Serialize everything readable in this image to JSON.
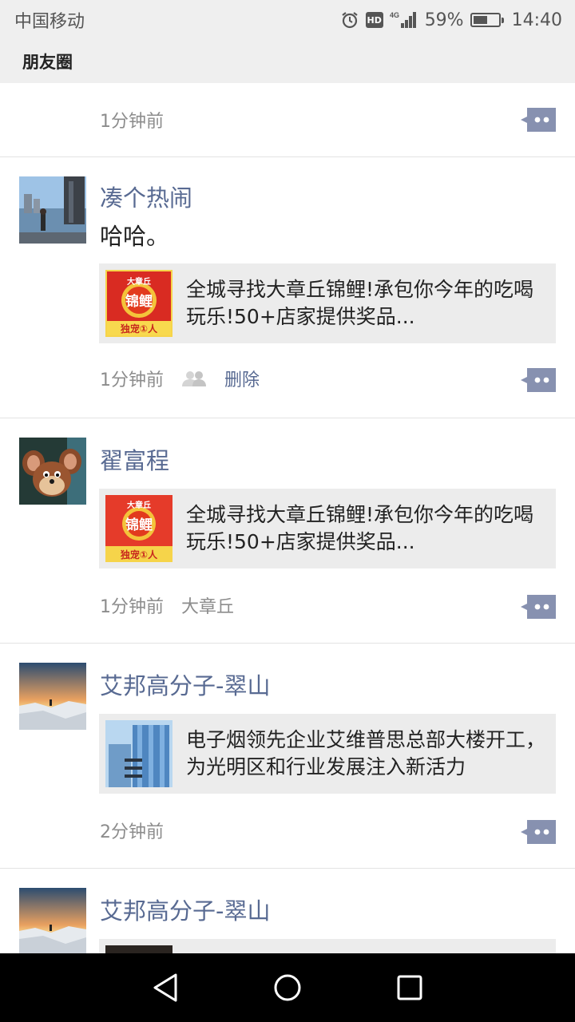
{
  "status_bar": {
    "carrier": "中国移动",
    "network": "4G",
    "battery": "59%",
    "battery_level": 0.59,
    "time": "14:40",
    "hd_label": "HD"
  },
  "header": {
    "title": "朋友圈"
  },
  "posts": [
    {
      "time": "1分钟前"
    },
    {
      "name": "凑个热闹",
      "text": "哈哈。",
      "share_title": "全城寻找大章丘锦鲤!承包你今年的吃喝玩乐!50+店家提供奖品...",
      "time": "1分钟前",
      "delete_label": "删除"
    },
    {
      "name": "翟富程",
      "share_title": "全城寻找大章丘锦鲤!承包你今年的吃喝玩乐!50+店家提供奖品...",
      "time": "1分钟前",
      "location": "大章丘"
    },
    {
      "name": "艾邦高分子-翠山",
      "share_title": "电子烟领先企业艾维普思总部大楼开工，为光明区和行业发展注入新活力",
      "time": "2分钟前"
    },
    {
      "name": "艾邦高分子-翠山"
    }
  ],
  "thumb_text": {
    "top": "大章丘",
    "main": "锦鲤",
    "bottom": "独宠①人"
  },
  "colors": {
    "name_blue": "#586a92",
    "action_btn": "#8791b0",
    "bar_bg": "#efefef",
    "card_bg": "#ececec"
  },
  "icons": [
    "alarm-icon",
    "signal-icon",
    "battery-icon",
    "privacy-icon",
    "comment-icon",
    "back-icon",
    "home-icon",
    "recents-icon"
  ]
}
